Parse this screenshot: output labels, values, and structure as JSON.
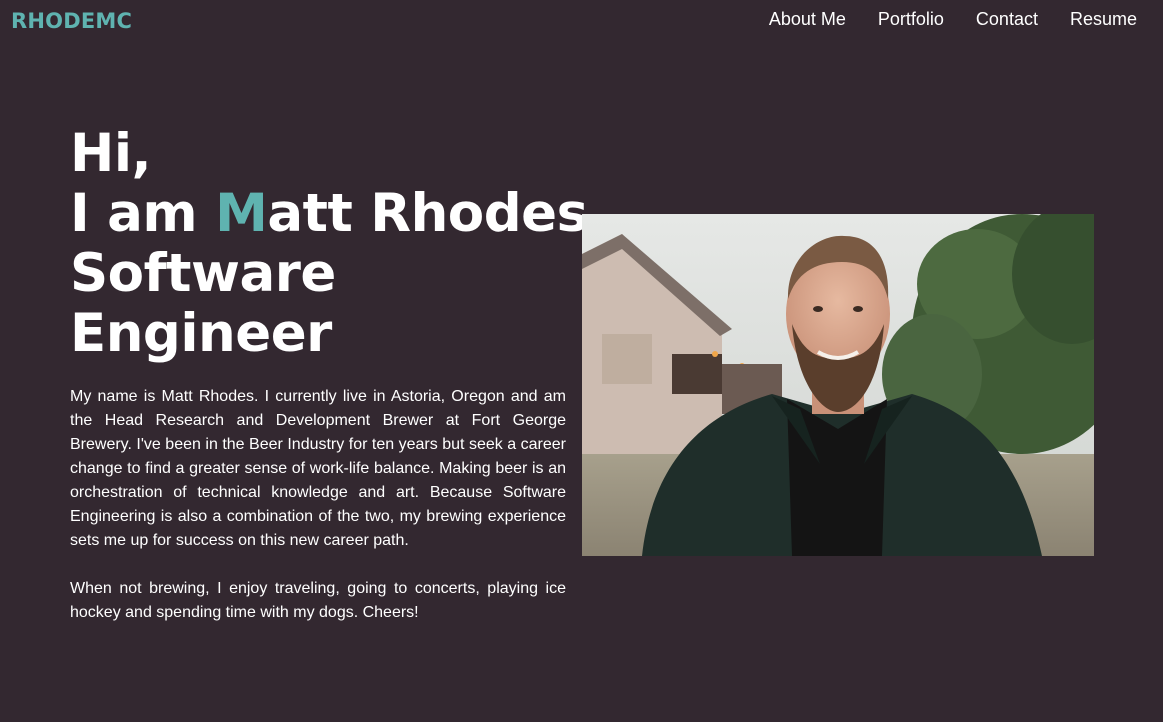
{
  "nav": {
    "brand": "RHODEMC",
    "links": [
      {
        "label": "About Me"
      },
      {
        "label": "Portfolio"
      },
      {
        "label": "Contact"
      },
      {
        "label": "Resume"
      }
    ]
  },
  "hero": {
    "greeting": "Hi,",
    "intro_prefix": "I am ",
    "name_initial": "M",
    "name_rest": "att Rhodes",
    "title_line1": "Software",
    "title_line2": "Engineer"
  },
  "bio": {
    "paragraph1": "My name is Matt Rhodes. I currently live in Astoria, Oregon and am the Head Research and Development Brewer at Fort George Brewery. I've been in the Beer Industry for ten years but seek a career change to find a greater sense of work-life balance. Making beer is an orchestration of technical knowledge and art. Because Software Engineering is also a combination of the two, my brewing experience sets me up for success on this new career path.",
    "paragraph2": "When not brewing, I enjoy traveling, going to concerts, playing ice hockey and spending time with my dogs. Cheers!"
  },
  "colors": {
    "background": "#332830",
    "accent": "#5fb3b0",
    "text": "#ffffff"
  }
}
